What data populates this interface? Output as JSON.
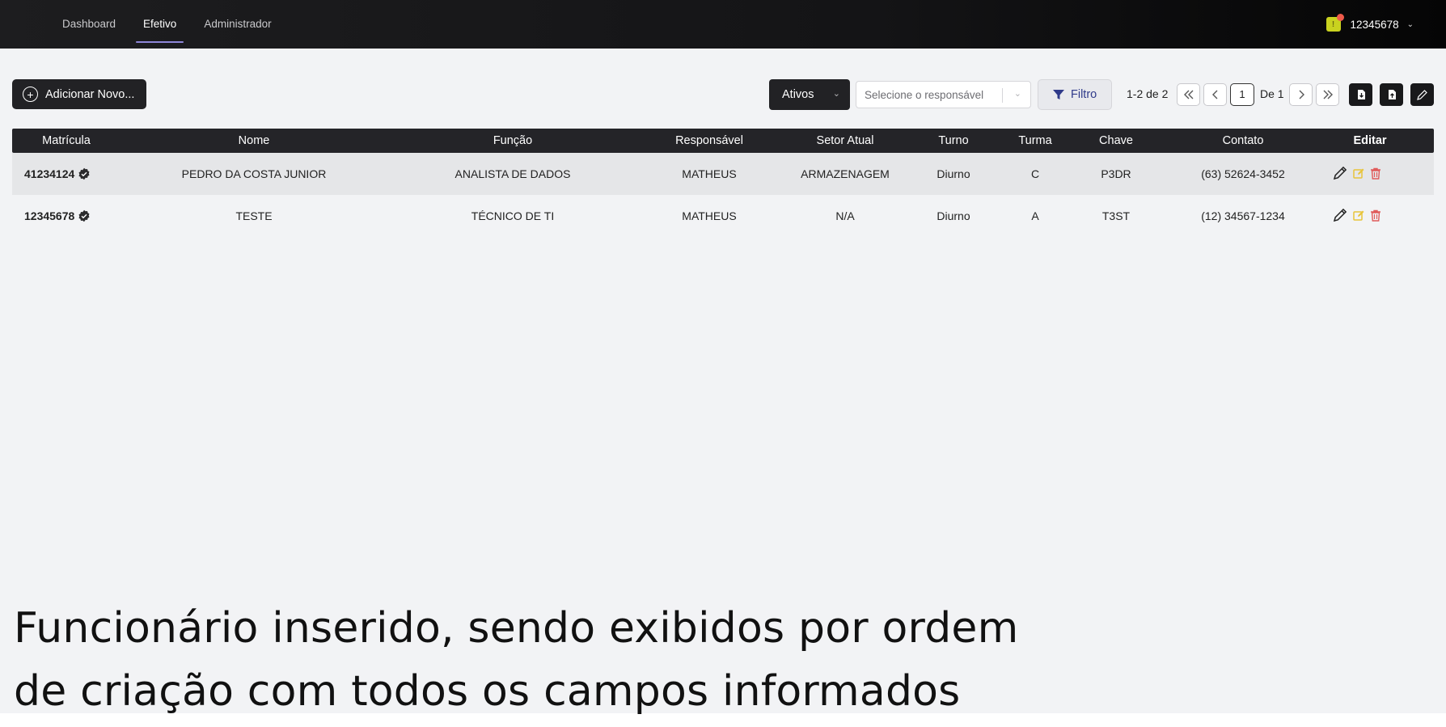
{
  "nav": {
    "items": [
      {
        "label": "Dashboard",
        "active": false
      },
      {
        "label": "Efetivo",
        "active": true
      },
      {
        "label": "Administrador",
        "active": false
      }
    ]
  },
  "user": {
    "id": "12345678"
  },
  "toolbar": {
    "add_label": "Adicionar Novo...",
    "status_value": "Ativos",
    "responsavel_placeholder": "Selecione o responsável",
    "filter_label": "Filtro",
    "pagination": {
      "range": "1-2 de 2",
      "current_page": "1",
      "of_label": "De 1"
    }
  },
  "table": {
    "columns": [
      "Matrícula",
      "Nome",
      "Função",
      "Responsável",
      "Setor Atual",
      "Turno",
      "Turma",
      "Chave",
      "Contato",
      "Editar"
    ],
    "rows": [
      {
        "matricula": "41234124",
        "nome": "PEDRO DA COSTA JUNIOR",
        "funcao": "ANALISTA DE DADOS",
        "responsavel": "MATHEUS",
        "setor": "ARMAZENAGEM",
        "turno": "Diurno",
        "turma": "C",
        "chave": "P3DR",
        "contato": "(63) 52624-3452"
      },
      {
        "matricula": "12345678",
        "nome": "TESTE",
        "funcao": "TÉCNICO DE TI",
        "responsavel": "MATHEUS",
        "setor": "N/A",
        "turno": "Diurno",
        "turma": "A",
        "chave": "T3ST",
        "contato": "(12) 34567-1234"
      }
    ]
  },
  "caption": {
    "line1": "Funcionário inserido, sendo exibidos por ordem",
    "line2": "de criação com todos os campos informados"
  },
  "colors": {
    "accent": "#8e86d8",
    "filter_text": "#2f3a8a",
    "edit_icon": "#e8c43a",
    "delete_icon": "#e05a5a"
  }
}
